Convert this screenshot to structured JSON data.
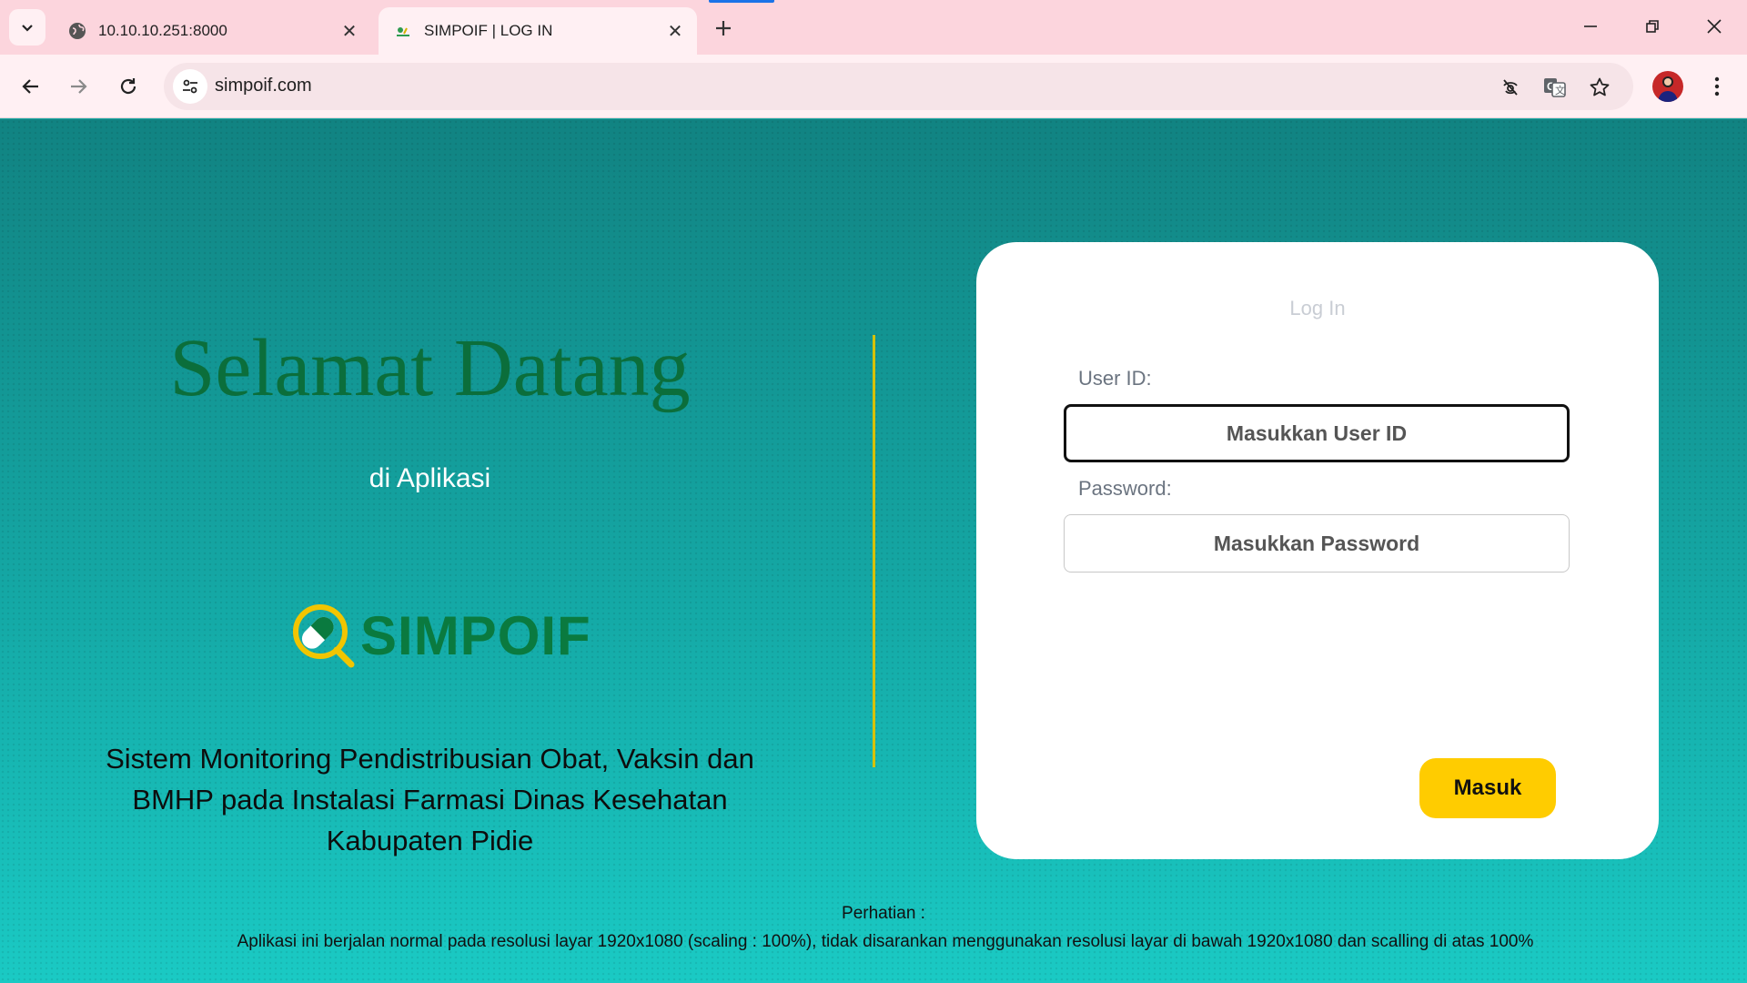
{
  "browser": {
    "tabs": [
      {
        "title": "10.10.10.251:8000",
        "active": false,
        "favicon": "globe-icon"
      },
      {
        "title": "SIMPOIF | LOG IN",
        "active": true,
        "favicon": "simpoif-favicon"
      }
    ],
    "url": "simpoif.com",
    "accent_color": "#1a73e8",
    "chrome_color": "#fcd5dd"
  },
  "page": {
    "welcome": "Selamat Datang",
    "subtitle": "di Aplikasi",
    "logo_text": "SIMPOIF",
    "description": "Sistem Monitoring Pendistribusian Obat, Vaksin dan BMHP pada Instalasi Farmasi Dinas Kesehatan Kabupaten Pidie",
    "login": {
      "title": "Log In",
      "user_label": "User ID:",
      "user_placeholder": "Masukkan User ID",
      "password_label": "Password:",
      "password_placeholder": "Masukkan Password",
      "submit": "Masuk"
    },
    "notice_title": "Perhatian :",
    "notice_text": "Aplikasi ini berjalan normal pada resolusi layar 1920x1080 (scaling : 100%), tidak disarankan menggunakan resolusi layar di bawah 1920x1080 dan scalling di atas 100%",
    "colors": {
      "welcome": "#0b6e3b",
      "button": "#ffcc00",
      "divider": "#d6c200",
      "background_top": "#118382",
      "background_bottom": "#1acac4"
    }
  }
}
